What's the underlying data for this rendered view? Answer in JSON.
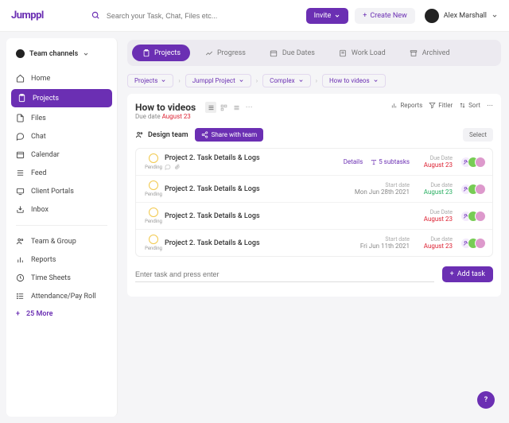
{
  "brand": "Jumppl",
  "search": {
    "placeholder": "Search your Task, Chat, Files etc..."
  },
  "header": {
    "invite": "Invite",
    "create_new": "Create New",
    "user": "Alex Marshall"
  },
  "sidebar": {
    "team_switch": "Team channels",
    "items": [
      {
        "label": "Home"
      },
      {
        "label": "Projects"
      },
      {
        "label": "Files"
      },
      {
        "label": "Chat"
      },
      {
        "label": "Calendar"
      },
      {
        "label": "Feed"
      },
      {
        "label": "Client Portals"
      },
      {
        "label": "Inbox"
      }
    ],
    "secondary": [
      {
        "label": "Team & Group"
      },
      {
        "label": "Reports"
      },
      {
        "label": "Time Sheets"
      },
      {
        "label": "Attendance/Pay Roll"
      }
    ],
    "more": "25 More"
  },
  "tabs": [
    {
      "label": "Projects"
    },
    {
      "label": "Progress"
    },
    {
      "label": "Due Dates"
    },
    {
      "label": "Work Load"
    },
    {
      "label": "Archived"
    }
  ],
  "breadcrumbs": [
    "Projects",
    "Jumppl Project",
    "Complex",
    "How to videos"
  ],
  "page": {
    "title": "How to videos",
    "due_prefix": "Due date",
    "due_date": "August 23"
  },
  "toolbar": {
    "reports": "Reports",
    "filter": "Fitler",
    "sort": "Sort"
  },
  "team_row": {
    "label": "Design team",
    "share": "Share with team",
    "select": "Select"
  },
  "tasks": [
    {
      "title": "Project 2. Task Details & Logs",
      "status": "Pending",
      "details": "Details",
      "subtasks": "5 subtasks",
      "due_label": "Due Date",
      "due_value": "August 23",
      "due_color": "red",
      "has_icons": true
    },
    {
      "title": "Project 2. Task Details & Logs",
      "status": "Pending",
      "start_label": "Start date",
      "start_value": "Mon Jun 28th  2021",
      "due_label": "Due date",
      "due_value": "August 23",
      "due_color": "green"
    },
    {
      "title": "Project 2. Task Details & Logs",
      "status": "Pending",
      "due_label": "Due Date",
      "due_value": "August 23",
      "due_color": "red"
    },
    {
      "title": "Project 2. Task Details & Logs",
      "status": "Pending",
      "start_label": "Start date",
      "start_value": "Fri Jun 11th  2021",
      "due_label": "Due date",
      "due_value": "August 23",
      "due_color": "red"
    }
  ],
  "input": {
    "placeholder": "Enter task and press enter",
    "add": "Add task"
  },
  "fab": "?"
}
